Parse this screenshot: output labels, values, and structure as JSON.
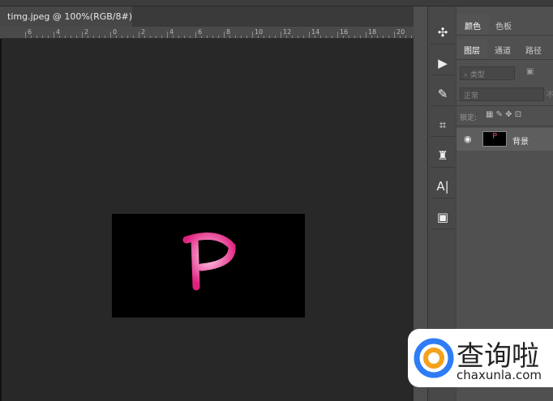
{
  "document": {
    "tab_title": "timg.jpeg @ 100%(RGB/8#)"
  },
  "ruler": {
    "labels": [
      "6",
      "4",
      "2",
      "0",
      "2",
      "4",
      "6",
      "8",
      "10",
      "12",
      "14",
      "16",
      "18",
      "20"
    ]
  },
  "toolbar": {
    "collapse": "‹‹",
    "tools": [
      "puzzle",
      "play",
      "brush",
      "crop",
      "stamp",
      "text",
      "3d"
    ]
  },
  "panel": {
    "top_tabs": [
      "颜色",
      "色板"
    ],
    "layer_tabs": [
      "图层",
      "通道",
      "路径"
    ],
    "filter_placeholder": "类型",
    "blend_mode": "正常",
    "opacity_label": "不",
    "lock_label": "锁定:",
    "layer": {
      "name": "背景",
      "thumb": "P"
    }
  },
  "watermark": {
    "brand": "查询啦",
    "url": "chaxunla.com"
  }
}
